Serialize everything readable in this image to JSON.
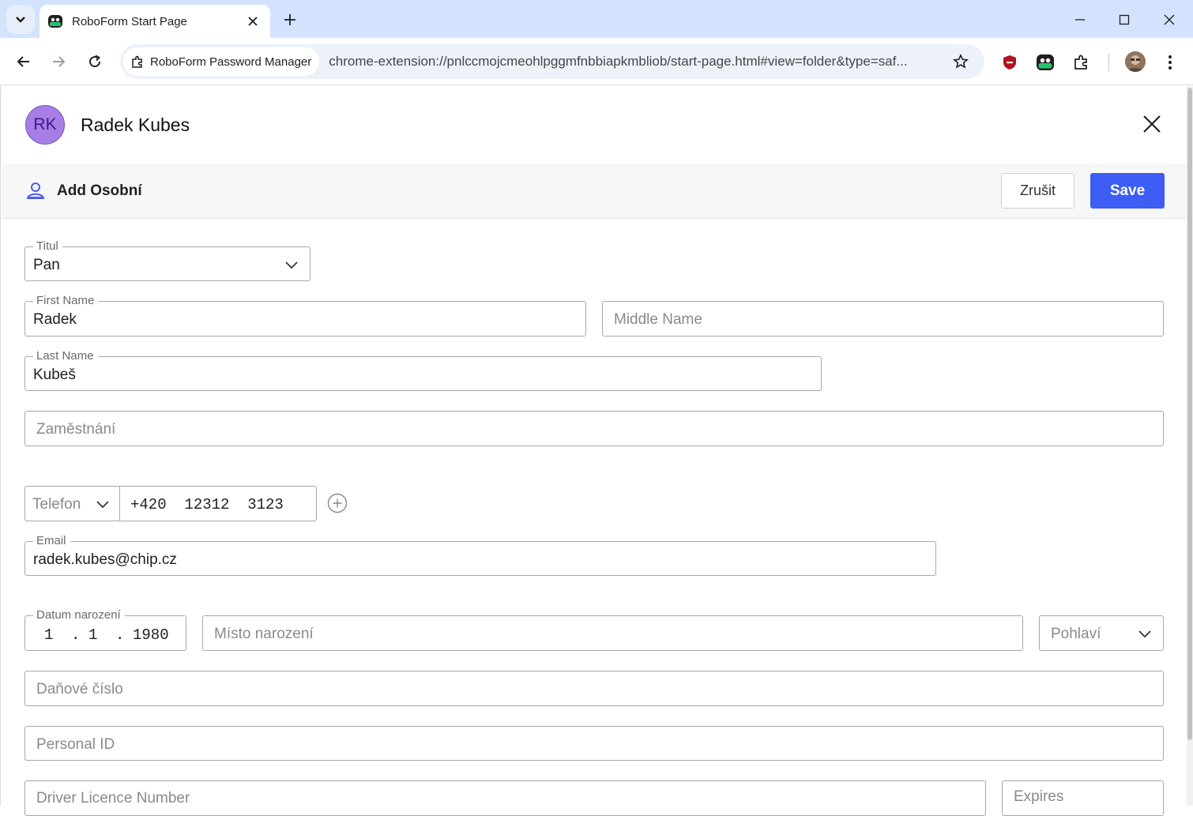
{
  "browser": {
    "tab_title": "RoboForm Start Page",
    "site_chip": "RoboForm Password Manager",
    "url": "chrome-extension://pnlccmojcmeohlpggmfnbbiapkmbliob/start-page.html#view=folder&type=saf..."
  },
  "header": {
    "avatar_initials": "RK",
    "user_name": "Radek Kubes"
  },
  "subbar": {
    "title": "Add Osobní",
    "cancel_label": "Zrušit",
    "save_label": "Save"
  },
  "form": {
    "titul": {
      "label": "Titul",
      "value": "Pan"
    },
    "first_name": {
      "label": "First Name",
      "value": "Radek"
    },
    "middle_name": {
      "placeholder": "Middle Name"
    },
    "last_name": {
      "label": "Last Name",
      "value": "Kubeš"
    },
    "occupation": {
      "placeholder": "Zaměstnání"
    },
    "phone": {
      "type_placeholder": "Telefon",
      "value": "+420  12312  3123"
    },
    "email": {
      "label": "Email",
      "value": "radek.kubes@chip.cz"
    },
    "birth_date": {
      "label": "Datum narození",
      "day": "1",
      "month": "1",
      "year": "1980",
      "separator": "."
    },
    "birth_place": {
      "placeholder": "Místo narození"
    },
    "gender": {
      "placeholder": "Pohlaví"
    },
    "tax_number": {
      "placeholder": "Daňové číslo"
    },
    "personal_id": {
      "placeholder": "Personal ID"
    },
    "driver_licence": {
      "placeholder": "Driver Licence Number"
    },
    "expires": {
      "placeholder": "Expires"
    }
  },
  "colors": {
    "accent": "#3d5df5",
    "avatar_bg": "#a77ee6",
    "tabstrip": "#d3e3fd"
  }
}
